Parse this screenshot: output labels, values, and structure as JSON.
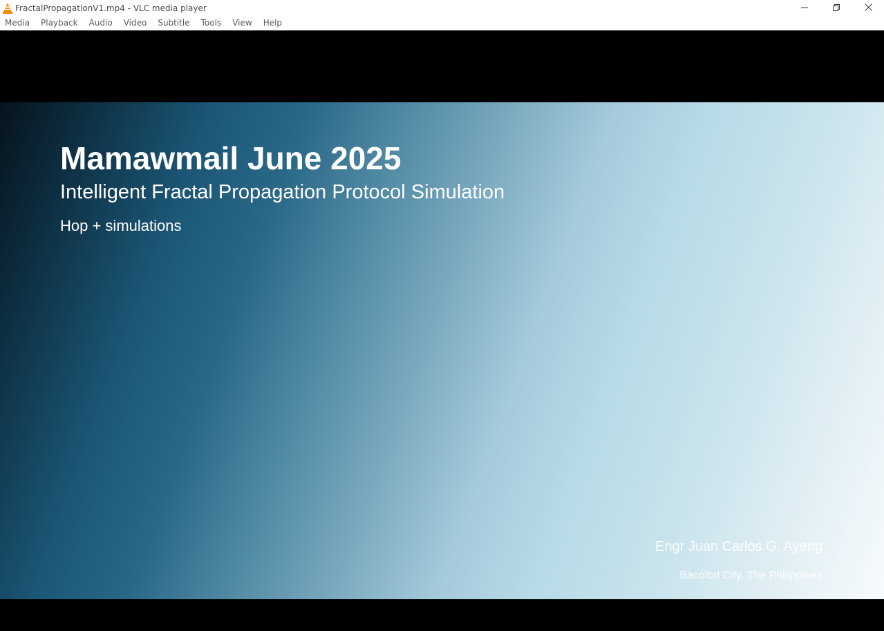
{
  "window": {
    "title": "FractalPropagationV1.mp4 - VLC media player",
    "icon": "vlc-cone-icon",
    "controls": {
      "minimize_icon": "minimize-icon",
      "restore_icon": "restore-icon",
      "close_icon": "close-icon"
    }
  },
  "menu": {
    "items": [
      "Media",
      "Playback",
      "Audio",
      "Video",
      "Subtitle",
      "Tools",
      "View",
      "Help"
    ]
  },
  "video": {
    "title": "Mamawmail June 2025",
    "subtitle": "Intelligent Fractal Propagation Protocol Simulation",
    "subtitle2": "Hop + simulations",
    "author": "Engr Juan Carlos G. Ayeng",
    "location": "Bacolod City, The Philippines"
  },
  "colors": {
    "titlebar_bg": "#ffffff",
    "video_bg": "#000000",
    "vlc_orange": "#f28c00",
    "gradient_dark": "#06131c",
    "gradient_mid": "#2a6888",
    "gradient_light": "#f7fbfd"
  }
}
